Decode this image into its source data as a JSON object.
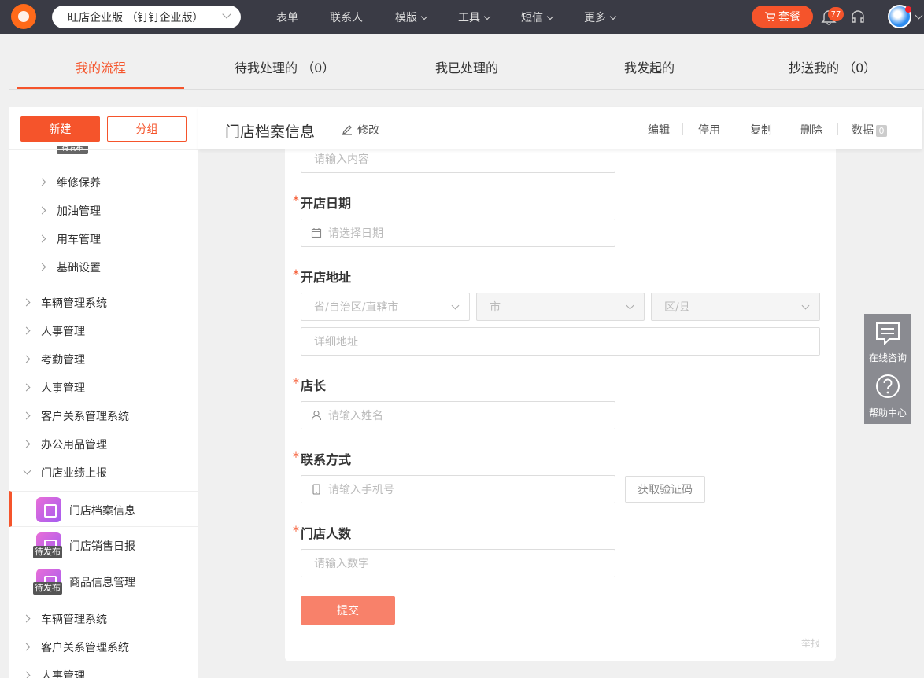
{
  "topbar": {
    "org_name": "旺店企业版 （钉钉企业版）",
    "nav": [
      {
        "label": "表单",
        "has_menu": false
      },
      {
        "label": "联系人",
        "has_menu": false
      },
      {
        "label": "模版",
        "has_menu": true
      },
      {
        "label": "工具",
        "has_menu": true
      },
      {
        "label": "短信",
        "has_menu": true
      },
      {
        "label": "更多",
        "has_menu": true
      }
    ],
    "package_label": "套餐",
    "notification_count": "77"
  },
  "tabs": [
    {
      "label": "我的流程",
      "active": true
    },
    {
      "label": "待我处理的 （0）",
      "active": false
    },
    {
      "label": "我已处理的",
      "active": false
    },
    {
      "label": "我发起的",
      "active": false
    },
    {
      "label": "抄送我的 （0）",
      "active": false
    }
  ],
  "sidebar": {
    "new_label": "新建",
    "group_label": "分组",
    "cut_tag": "待发布",
    "sub_items": [
      "维修保养",
      "加油管理",
      "用车管理",
      "基础设置"
    ],
    "groups": [
      "车辆管理系统",
      "人事管理",
      "考勤管理",
      "人事管理",
      "客户关系管理系统",
      "办公用品管理",
      "门店业绩上报"
    ],
    "apps": [
      {
        "label": "门店档案信息",
        "tag": ""
      },
      {
        "label": "门店销售日报",
        "tag": "待发布"
      },
      {
        "label": "商品信息管理",
        "tag": "待发布"
      }
    ],
    "groups_after": [
      "车辆管理系统",
      "客户关系管理系统",
      "人事管理"
    ]
  },
  "content_header": {
    "title": "门店档案信息",
    "edit_label": "修改",
    "actions": [
      "编辑",
      "停用",
      "复制",
      "删除"
    ],
    "data_label": "数据",
    "data_count": "0"
  },
  "form": {
    "top_placeholder": "请输入内容",
    "open_date": {
      "label": "开店日期",
      "placeholder": "请选择日期"
    },
    "address": {
      "label": "开店地址",
      "province": "省/自治区/直辖市",
      "city": "市",
      "district": "区/县",
      "detail": "详细地址"
    },
    "manager": {
      "label": "店长",
      "placeholder": "请输入姓名"
    },
    "contact": {
      "label": "联系方式",
      "placeholder": "请输入手机号",
      "code_button": "获取验证码"
    },
    "staff_count": {
      "label": "门店人数",
      "placeholder": "请输入数字"
    },
    "required_mark": "*",
    "submit_label": "提交",
    "report_label": "举报"
  },
  "float_help": {
    "consult_label": "在线咨询",
    "help_label": "帮助中心"
  },
  "colors": {
    "accent": "#f5542b",
    "topbar_bg": "#3a3b45"
  }
}
